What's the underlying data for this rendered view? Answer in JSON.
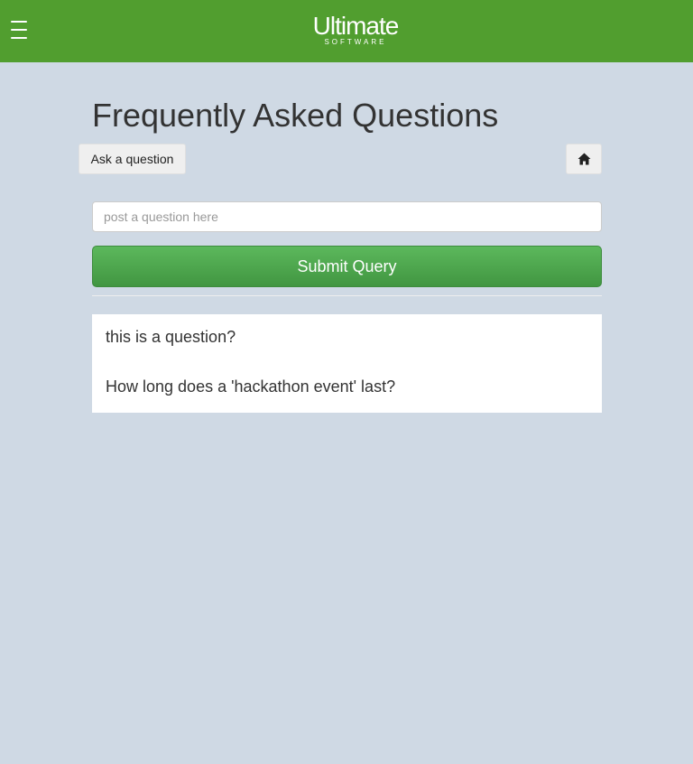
{
  "header": {
    "menu_icon": "hamburger-menu-icon",
    "logo_main": "Ultimate",
    "logo_sub": "SOFTWARE",
    "background_color": "#519e2f"
  },
  "page": {
    "title": "Frequently Asked Questions",
    "background_color": "#cfd9e4"
  },
  "toolbar": {
    "ask_button_label": "Ask a question",
    "home_icon": "home-icon"
  },
  "form": {
    "question_placeholder": "post a question here",
    "question_value": "",
    "submit_label": "Submit Query",
    "submit_color": "#5cb85c"
  },
  "questions": [
    "this is a question?",
    "How long does a 'hackathon event' last?"
  ]
}
